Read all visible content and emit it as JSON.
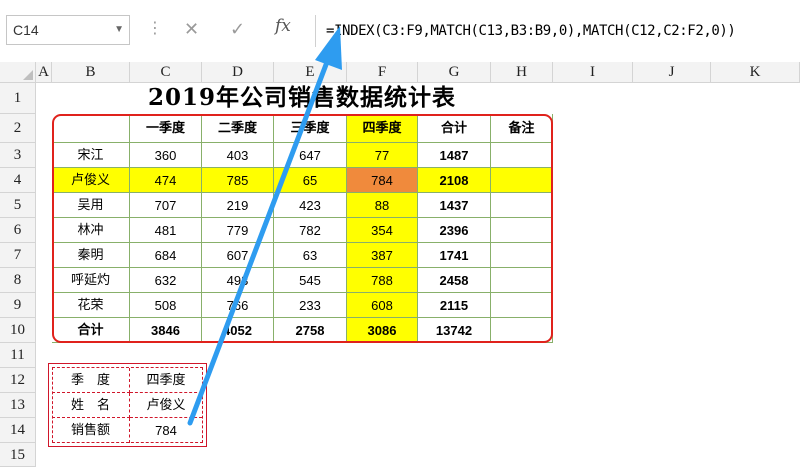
{
  "formula_bar": {
    "name_box": "C14",
    "cancel_glyph": "✕",
    "enter_glyph": "✓",
    "fx_label": "fx",
    "formula": "=INDEX(C3:F9,MATCH(C13,B3:B9,0),MATCH(C12,C2:F2,0))"
  },
  "columns": [
    "A",
    "B",
    "C",
    "D",
    "E",
    "F",
    "G",
    "H",
    "I",
    "J",
    "K"
  ],
  "rows": [
    "1",
    "2",
    "3",
    "4",
    "5",
    "6",
    "7",
    "8",
    "9",
    "10",
    "11",
    "12",
    "13",
    "14",
    "15"
  ],
  "title": "2019年公司销售数据统计表",
  "table": {
    "headers": [
      "",
      "一季度",
      "二季度",
      "三季度",
      "四季度",
      "合计",
      "备注"
    ],
    "rows": [
      {
        "name": "宋江",
        "q": [
          "360",
          "403",
          "647",
          "77"
        ],
        "total": "1487",
        "note": ""
      },
      {
        "name": "卢俊义",
        "q": [
          "474",
          "785",
          "65",
          "784"
        ],
        "total": "2108",
        "note": ""
      },
      {
        "name": "吴用",
        "q": [
          "707",
          "219",
          "423",
          "88"
        ],
        "total": "1437",
        "note": ""
      },
      {
        "name": "林冲",
        "q": [
          "481",
          "779",
          "782",
          "354"
        ],
        "total": "2396",
        "note": ""
      },
      {
        "name": "秦明",
        "q": [
          "684",
          "607",
          "63",
          "387"
        ],
        "total": "1741",
        "note": ""
      },
      {
        "name": "呼延灼",
        "q": [
          "632",
          "493",
          "545",
          "788"
        ],
        "total": "2458",
        "note": ""
      },
      {
        "name": "花荣",
        "q": [
          "508",
          "766",
          "233",
          "608"
        ],
        "total": "2115",
        "note": ""
      }
    ],
    "total_row": {
      "name": "合计",
      "q": [
        "3846",
        "4052",
        "2758",
        "3086"
      ],
      "total": "13742",
      "note": ""
    }
  },
  "lookup": [
    {
      "label": "季　度",
      "value": "四季度"
    },
    {
      "label": "姓　名",
      "value": "卢俊义"
    },
    {
      "label": "销售额",
      "value": "784"
    }
  ],
  "colors": {
    "highlight": "#ffff00",
    "selected_cell": "#f08a3c",
    "table_border": "#e0221c",
    "arrow": "#2e9cf0"
  }
}
